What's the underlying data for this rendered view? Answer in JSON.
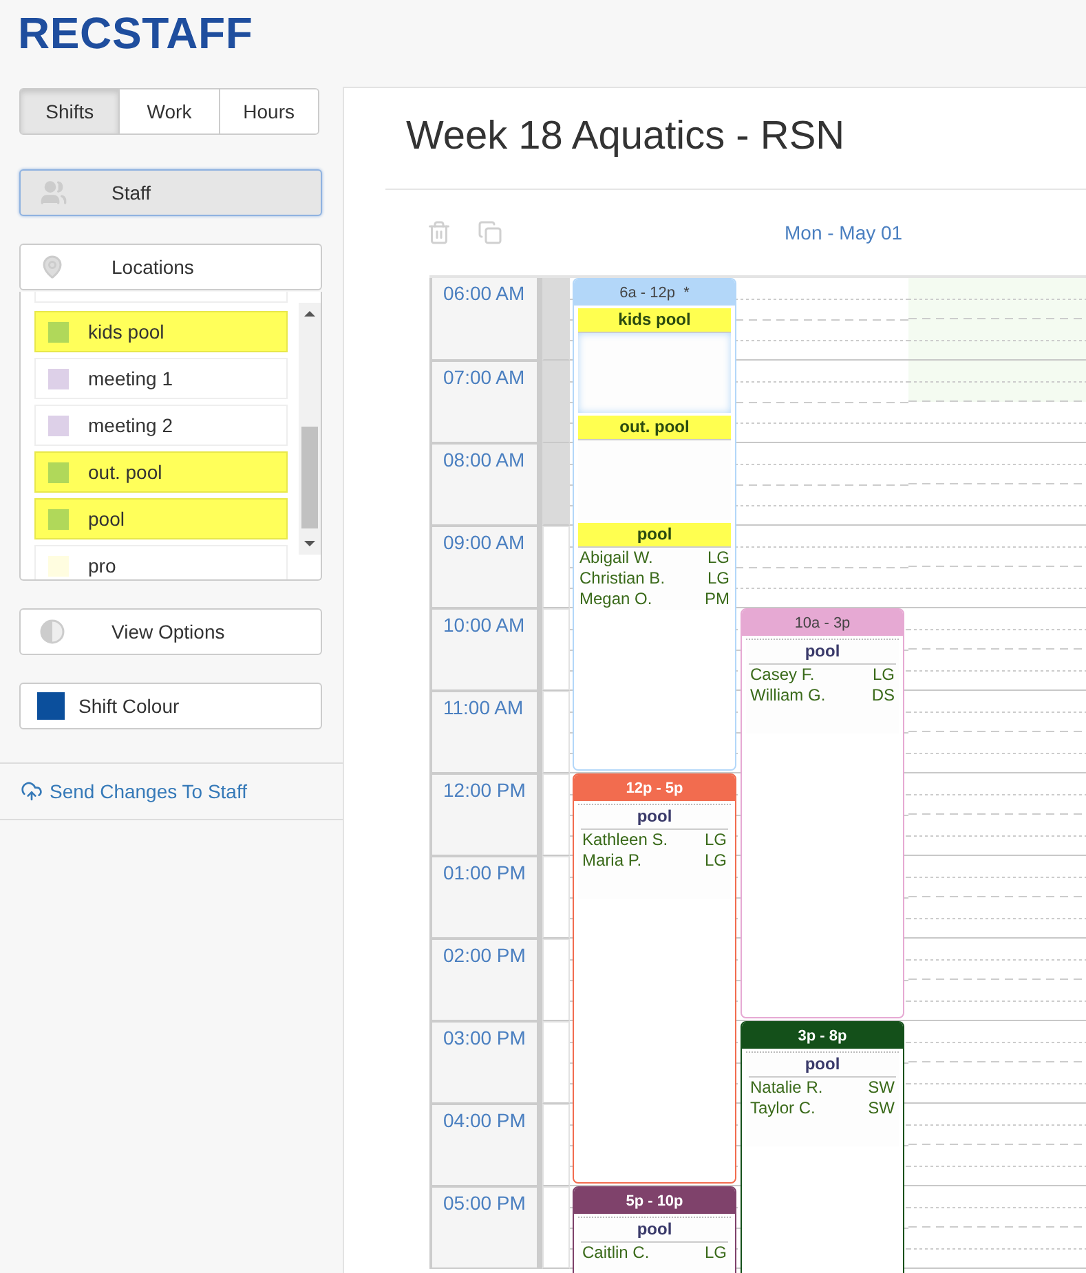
{
  "logo": "RECSTAFF",
  "view_tabs": [
    {
      "label": "Shifts",
      "selected": true
    },
    {
      "label": "Work",
      "selected": false
    },
    {
      "label": "Hours",
      "selected": false
    }
  ],
  "sidebar": {
    "staff_button": {
      "label": "Staff",
      "selected": true
    },
    "locations_button": {
      "label": "Locations",
      "selected": false
    },
    "locations": [
      {
        "name": "kids pool",
        "color": "#b0d85a",
        "selected": true
      },
      {
        "name": "meeting 1",
        "color": "#ddd0e8",
        "selected": false
      },
      {
        "name": "meeting 2",
        "color": "#ddd0e8",
        "selected": false
      },
      {
        "name": "out. pool",
        "color": "#b0d85a",
        "selected": true
      },
      {
        "name": "pool",
        "color": "#b0d85a",
        "selected": true
      },
      {
        "name": "pro",
        "color": "#fffde0",
        "selected": false
      }
    ],
    "view_options": "View Options",
    "shift_colour": {
      "label": "Shift Colour",
      "color": "#0b4f9c"
    },
    "send_link": "Send Changes To Staff"
  },
  "schedule": {
    "title": "Week 18 Aquatics - RSN",
    "day_label": "Mon - May 01",
    "hours": [
      {
        "label": "06:00 AM",
        "gutter_shaded": true,
        "available": [
          true,
          true
        ]
      },
      {
        "label": "07:00 AM",
        "gutter_shaded": true,
        "available": [
          true,
          false
        ]
      },
      {
        "label": "08:00 AM",
        "gutter_shaded": true,
        "available": [
          false,
          false
        ]
      },
      {
        "label": "09:00 AM",
        "gutter_shaded": false,
        "available": [
          false,
          false
        ]
      },
      {
        "label": "10:00 AM",
        "gutter_shaded": false,
        "available": [
          false,
          false
        ]
      },
      {
        "label": "11:00 AM",
        "gutter_shaded": false,
        "available": [
          false,
          false
        ]
      },
      {
        "label": "12:00 PM",
        "gutter_shaded": false,
        "available": [
          false,
          false
        ]
      },
      {
        "label": "01:00 PM",
        "gutter_shaded": false,
        "available": [
          false,
          false
        ]
      },
      {
        "label": "02:00 PM",
        "gutter_shaded": false,
        "available": [
          false,
          false
        ]
      },
      {
        "label": "03:00 PM",
        "gutter_shaded": false,
        "available": [
          false,
          false
        ]
      },
      {
        "label": "04:00 PM",
        "gutter_shaded": false,
        "available": [
          false,
          false
        ]
      },
      {
        "label": "05:00 PM",
        "gutter_shaded": false,
        "available": [
          false,
          false
        ]
      }
    ],
    "columns": [
      {
        "shifts": [
          {
            "time": "6a - 12p  *",
            "color": "#b3d7f9",
            "locations": [
              {
                "name": "kids pool",
                "highlighted": true
              },
              {
                "name": "out. pool",
                "highlighted": true
              },
              {
                "name": "pool",
                "highlighted": true,
                "staff": [
                  {
                    "name": "Abigail W.",
                    "role": "LG"
                  },
                  {
                    "name": "Christian B.",
                    "role": "LG"
                  },
                  {
                    "name": "Megan O.",
                    "role": "PM"
                  }
                ]
              }
            ]
          },
          {
            "time": "12p - 5p",
            "color": "#f26c4f",
            "locations": [
              {
                "name": "pool",
                "highlighted": false,
                "staff": [
                  {
                    "name": "Kathleen S.",
                    "role": "LG"
                  },
                  {
                    "name": "Maria P.",
                    "role": "LG"
                  }
                ]
              }
            ]
          },
          {
            "time": "5p - 10p",
            "color": "#7f426b",
            "locations": [
              {
                "name": "pool",
                "highlighted": false,
                "staff": [
                  {
                    "name": "Caitlin C.",
                    "role": "LG"
                  }
                ]
              }
            ]
          }
        ]
      },
      {
        "shifts": [
          {
            "time": "10a - 3p",
            "color": "#e6a9d3",
            "locations": [
              {
                "name": "pool",
                "highlighted": false,
                "staff": [
                  {
                    "name": "Casey F.",
                    "role": "LG"
                  },
                  {
                    "name": "William G.",
                    "role": "DS"
                  }
                ]
              }
            ]
          },
          {
            "time": "3p - 8p",
            "color": "#14501a",
            "locations": [
              {
                "name": "pool",
                "highlighted": false,
                "staff": [
                  {
                    "name": "Natalie R.",
                    "role": "SW"
                  },
                  {
                    "name": "Taylor C.",
                    "role": "SW"
                  }
                ]
              }
            ]
          }
        ]
      }
    ]
  }
}
